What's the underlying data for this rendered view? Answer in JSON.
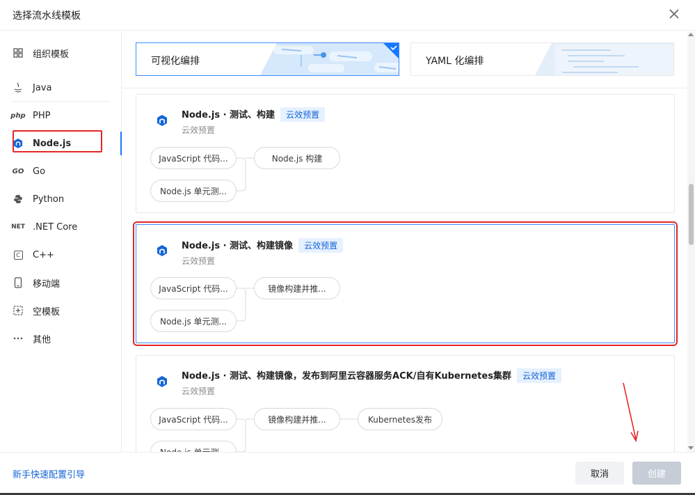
{
  "dialog": {
    "title": "选择流水线模板"
  },
  "sidebar": {
    "items": [
      {
        "label": "组织模板",
        "icon": "grid-icon"
      },
      {
        "label": "Java",
        "icon": "java-icon"
      },
      {
        "label": "PHP",
        "icon": "php-icon",
        "icon_text": "php"
      },
      {
        "label": "Node.js",
        "icon": "nodejs-icon",
        "active": true
      },
      {
        "label": "Go",
        "icon": "go-icon",
        "icon_text": "GO"
      },
      {
        "label": "Python",
        "icon": "python-icon"
      },
      {
        "label": ".NET Core",
        "icon": "dotnet-icon",
        "icon_text": "NET"
      },
      {
        "label": "C++",
        "icon": "cpp-icon",
        "icon_text": "C"
      },
      {
        "label": "移动端",
        "icon": "mobile-icon"
      },
      {
        "label": "空模板",
        "icon": "empty-template-icon"
      },
      {
        "label": "其他",
        "icon": "more-icon"
      }
    ]
  },
  "tabs": [
    {
      "label": "可视化编排",
      "selected": true
    },
    {
      "label": "YAML 化编排",
      "selected": false
    }
  ],
  "templates": [
    {
      "name": "Node.js · 测试、构建",
      "badge": "云效预置",
      "subtitle": "云效预置",
      "stages": [
        [
          "JavaScript 代码...",
          "Node.js 单元测..."
        ],
        [
          "Node.js 构建"
        ]
      ]
    },
    {
      "name": "Node.js · 测试、构建镜像",
      "badge": "云效预置",
      "subtitle": "云效预置",
      "stages": [
        [
          "JavaScript 代码...",
          "Node.js 单元测..."
        ],
        [
          "镜像构建并推..."
        ]
      ]
    },
    {
      "name": "Node.js · 测试、构建镜像，发布到阿里云容器服务ACK/自有Kubernetes集群",
      "badge": "云效预置",
      "subtitle": "云效预置",
      "stages": [
        [
          "JavaScript 代码...",
          "Node.js 单元测..."
        ],
        [
          "镜像构建并推..."
        ],
        [
          "Kubernetes发布"
        ]
      ]
    }
  ],
  "footer": {
    "guide_link": "新手快速配置引导",
    "cancel_label": "取消",
    "create_label": "创建"
  },
  "colors": {
    "accent": "#1677ff",
    "badge_bg": "#e6f1ff",
    "annotation_red": "#e32626",
    "disabled_button": "#c6cdd6"
  }
}
